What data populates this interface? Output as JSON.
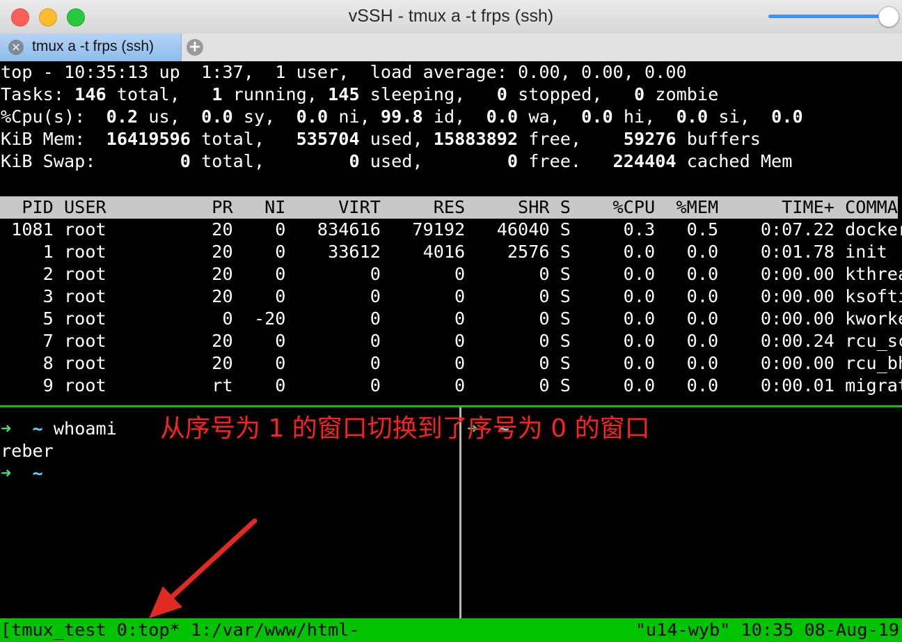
{
  "window": {
    "title": "vSSH - tmux a -t frps (ssh)"
  },
  "tabs": [
    {
      "label": "tmux a -t frps (ssh)",
      "close_icon": "×"
    }
  ],
  "new_tab_icon": "+",
  "top": {
    "summary": [
      {
        "segments": [
          {
            "t": "top - 10:35:13 up  1:37,  1 user,  load average: 0.00, 0.00, 0.00"
          }
        ]
      },
      {
        "segments": [
          {
            "t": "Tasks: "
          },
          {
            "t": "146",
            "b": true
          },
          {
            "t": " total,   "
          },
          {
            "t": "1",
            "b": true
          },
          {
            "t": " running, "
          },
          {
            "t": "145",
            "b": true
          },
          {
            "t": " sleeping,   "
          },
          {
            "t": "0",
            "b": true
          },
          {
            "t": " stopped,   "
          },
          {
            "t": "0",
            "b": true
          },
          {
            "t": " zombie"
          }
        ]
      },
      {
        "segments": [
          {
            "t": "%Cpu(s):  "
          },
          {
            "t": "0.2",
            "b": true
          },
          {
            "t": " us,  "
          },
          {
            "t": "0.0",
            "b": true
          },
          {
            "t": " sy,  "
          },
          {
            "t": "0.0",
            "b": true
          },
          {
            "t": " ni, "
          },
          {
            "t": "99.8",
            "b": true
          },
          {
            "t": " id,  "
          },
          {
            "t": "0.0",
            "b": true
          },
          {
            "t": " wa,  "
          },
          {
            "t": "0.0",
            "b": true
          },
          {
            "t": " hi,  "
          },
          {
            "t": "0.0",
            "b": true
          },
          {
            "t": " si,  "
          },
          {
            "t": "0.0",
            "b": true
          }
        ]
      },
      {
        "segments": [
          {
            "t": "KiB Mem:  "
          },
          {
            "t": "16419596",
            "b": true
          },
          {
            "t": " total,   "
          },
          {
            "t": "535704",
            "b": true
          },
          {
            "t": " used, "
          },
          {
            "t": "15883892",
            "b": true
          },
          {
            "t": " free,    "
          },
          {
            "t": "59276",
            "b": true
          },
          {
            "t": " buffers"
          }
        ]
      },
      {
        "segments": [
          {
            "t": "KiB Swap:        "
          },
          {
            "t": "0",
            "b": true
          },
          {
            "t": " total,        "
          },
          {
            "t": "0",
            "b": true
          },
          {
            "t": " used,        "
          },
          {
            "t": "0",
            "b": true
          },
          {
            "t": " free.   "
          },
          {
            "t": "224404",
            "b": true
          },
          {
            "t": " cached Mem"
          }
        ]
      }
    ],
    "columns": [
      "PID",
      "USER",
      "PR",
      "NI",
      "VIRT",
      "RES",
      "SHR",
      "S",
      "%CPU",
      "%MEM",
      "TIME+",
      "COMMAND"
    ],
    "processes": [
      [
        "1081",
        "root",
        "20",
        "0",
        "834616",
        "79192",
        "46040",
        "S",
        "0.3",
        "0.5",
        "0:07.22",
        "dockerd"
      ],
      [
        "1",
        "root",
        "20",
        "0",
        "33612",
        "4016",
        "2576",
        "S",
        "0.0",
        "0.0",
        "0:01.78",
        "init"
      ],
      [
        "2",
        "root",
        "20",
        "0",
        "0",
        "0",
        "0",
        "S",
        "0.0",
        "0.0",
        "0:00.00",
        "kthreadd"
      ],
      [
        "3",
        "root",
        "20",
        "0",
        "0",
        "0",
        "0",
        "S",
        "0.0",
        "0.0",
        "0:00.00",
        "ksoftir+"
      ],
      [
        "5",
        "root",
        "0",
        "-20",
        "0",
        "0",
        "0",
        "S",
        "0.0",
        "0.0",
        "0:00.00",
        "kworker+"
      ],
      [
        "7",
        "root",
        "20",
        "0",
        "0",
        "0",
        "0",
        "S",
        "0.0",
        "0.0",
        "0:00.24",
        "rcu_sch+"
      ],
      [
        "8",
        "root",
        "20",
        "0",
        "0",
        "0",
        "0",
        "S",
        "0.0",
        "0.0",
        "0:00.00",
        "rcu_bh"
      ],
      [
        "9",
        "root",
        "rt",
        "0",
        "0",
        "0",
        "0",
        "S",
        "0.0",
        "0.0",
        "0:00.01",
        "migrati+"
      ]
    ]
  },
  "left_pane": {
    "prompt_arrow": "➜",
    "prompt_tilde": "~",
    "command": "whoami",
    "output": "reber"
  },
  "right_pane": {
    "prompt_arrow": "➜",
    "prompt_tilde": "~"
  },
  "annotation": {
    "text": "从序号为 1 的窗口切换到了序号为 0 的窗口",
    "color": "#ff2020"
  },
  "status_bar": {
    "left": "[tmux_test 0:top* 1:/var/www/html-",
    "right": "\"u14-wyb\" 10:35 08-Aug-19",
    "color": "#00c400"
  }
}
